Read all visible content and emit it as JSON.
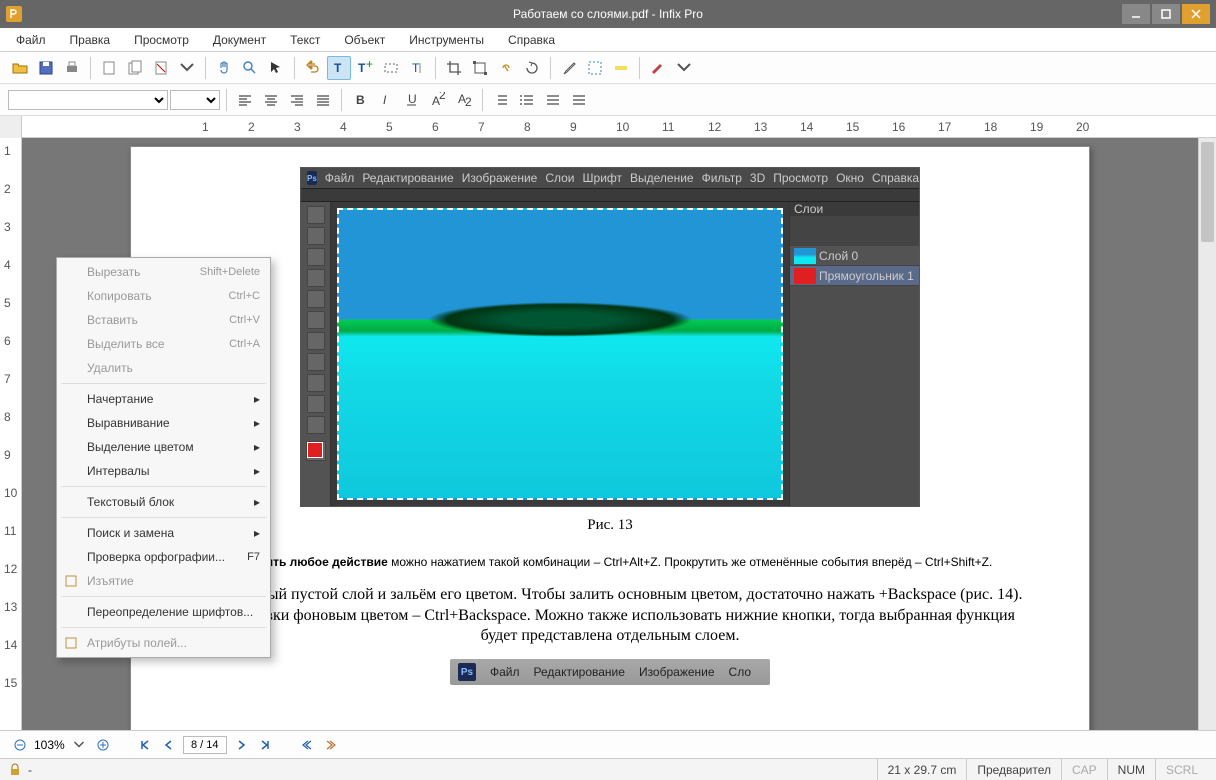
{
  "window": {
    "title": "Работаем со слоями.pdf - Infix Pro"
  },
  "menubar": [
    "Файл",
    "Правка",
    "Просмотр",
    "Документ",
    "Текст",
    "Объект",
    "Инструменты",
    "Справка"
  ],
  "contextmenu": {
    "items": [
      {
        "label": "Вырезать",
        "shortcut": "Shift+Delete",
        "disabled": true
      },
      {
        "label": "Копировать",
        "shortcut": "Ctrl+C",
        "disabled": true
      },
      {
        "label": "Вставить",
        "shortcut": "Ctrl+V",
        "disabled": true
      },
      {
        "label": "Выделить все",
        "shortcut": "Ctrl+A",
        "disabled": true
      },
      {
        "label": "Удалить",
        "disabled": true
      },
      {
        "sep": true
      },
      {
        "label": "Начертание",
        "submenu": true
      },
      {
        "label": "Выравнивание",
        "submenu": true
      },
      {
        "label": "Выделение цветом",
        "submenu": true
      },
      {
        "label": "Интервалы",
        "submenu": true
      },
      {
        "sep": true
      },
      {
        "label": "Текстовый блок",
        "submenu": true
      },
      {
        "sep": true
      },
      {
        "label": "Поиск и замена",
        "submenu": true
      },
      {
        "label": "Проверка орфографии...",
        "shortcut": "F7"
      },
      {
        "label": "Изъятие",
        "icon": "redact-icon",
        "disabled": true
      },
      {
        "sep": true
      },
      {
        "label": "Переопределение шрифтов..."
      },
      {
        "sep": true
      },
      {
        "label": "Атрибуты полей...",
        "icon": "tag-icon",
        "disabled": true
      }
    ]
  },
  "page_content": {
    "caption": "Рис. 13",
    "para1_bold": "Отменить любое действие",
    "para1_rest": " можно нажатием такой комбинации – Ctrl+Alt+Z. Прокрутить же отменённые события вперёд – Ctrl+Shift+Z.",
    "para2": "дадим новый пустой слой и зальём его цветом. Чтобы залить основным цветом, достаточно нажать +Backspace (рис. 14). Для заливки фоновым цветом – Ctrl+Backspace. Можно также использовать нижние кнопки, тогда выбранная функция будет представлена отдельным слоем.",
    "ps_menu": [
      "Файл",
      "Редактирование",
      "Изображение",
      "Сло"
    ],
    "ps_top_menu": [
      "Файл",
      "Редактирование",
      "Изображение",
      "Слои",
      "Шрифт",
      "Выделение",
      "Фильтр",
      "3D",
      "Просмотр",
      "Окно",
      "Справка"
    ],
    "ps_layers_hdr": "Слои",
    "ps_layer1": "Слой 0",
    "ps_layer2": "Прямоугольник 1"
  },
  "nav": {
    "zoom": "103%",
    "page": "8 / 14"
  },
  "status": {
    "dims": "21 x 29.7 cm",
    "hint": "Предварител",
    "caps": "CAP",
    "num": "NUM",
    "scrl": "SCRL"
  },
  "ruler_h": [
    1,
    2,
    3,
    4,
    5,
    6,
    7,
    8,
    9,
    10,
    11,
    12,
    13,
    14,
    15,
    16,
    17,
    18,
    19,
    20
  ],
  "ruler_v": [
    1,
    2,
    3,
    4,
    5,
    6,
    7,
    8,
    9,
    10,
    11,
    12,
    13,
    14,
    15
  ]
}
